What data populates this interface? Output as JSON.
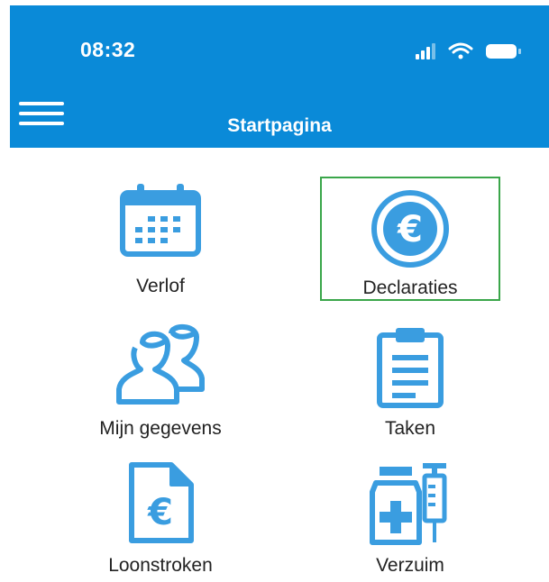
{
  "status_bar": {
    "time": "08:32"
  },
  "header": {
    "title": "Startpagina"
  },
  "tiles": [
    {
      "label": "Verlof",
      "icon": "calendar-icon"
    },
    {
      "label": "Declaraties",
      "icon": "euro-coin-icon",
      "selected": true
    },
    {
      "label": "Mijn gegevens",
      "icon": "people-icon"
    },
    {
      "label": "Taken",
      "icon": "clipboard-icon"
    },
    {
      "label": "Loonstroken",
      "icon": "euro-document-icon"
    },
    {
      "label": "Verzuim",
      "icon": "medicine-syringe-icon"
    }
  ],
  "colors": {
    "header_bg": "#0a8ad8",
    "icon": "#3a9de0",
    "selection_border": "#3aa64a"
  }
}
